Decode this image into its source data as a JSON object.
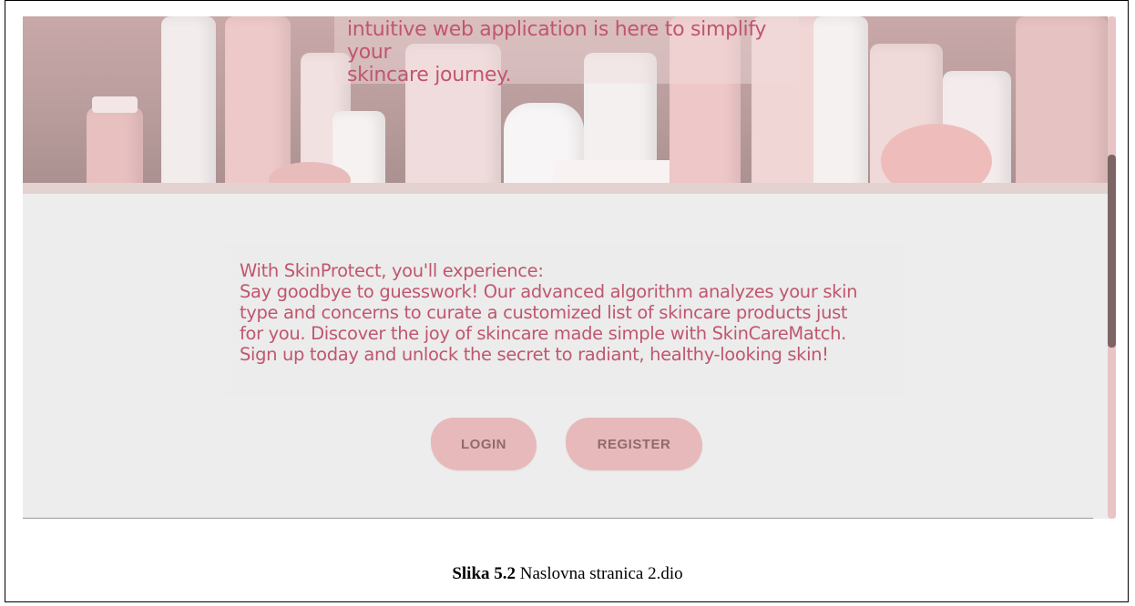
{
  "hero": {
    "intro_lines": [
      "intuitive web application is here to simplify your",
      "skincare journey."
    ]
  },
  "content": {
    "lines": [
      "With SkinProtect, you'll experience:",
      "Say goodbye to guesswork! Our advanced algorithm analyzes your skin",
      "type and concerns to curate a customized list of skincare products just",
      "for you. Discover the joy of skincare made simple with SkinCareMatch.",
      "Sign up today and unlock the secret to radiant, healthy-looking skin!"
    ]
  },
  "buttons": {
    "login": "LOGIN",
    "register": "REGISTER"
  },
  "caption": {
    "label": "Slika 5.2",
    "text": " Naslovna stranica 2.dio"
  },
  "colors": {
    "accent_text": "#c0566e",
    "button_bg": "#e7b9bb",
    "button_text": "#8f6b6d",
    "scroll_thumb": "#7d6565"
  }
}
